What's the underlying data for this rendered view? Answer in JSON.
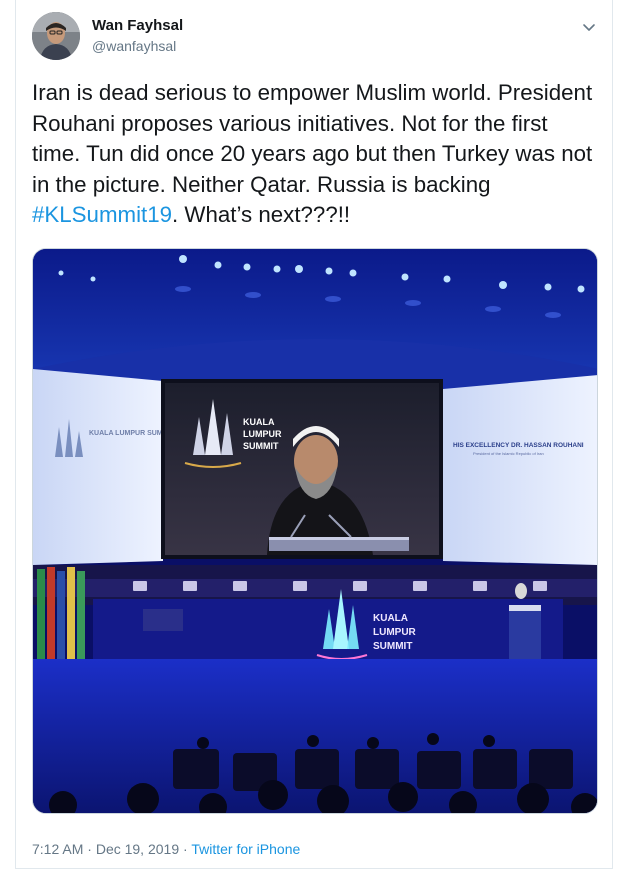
{
  "author": {
    "display_name": "Wan Fayhsal",
    "handle": "@wanfayhsal"
  },
  "tweet": {
    "text_before": "Iran is dead serious to empower Muslim world. President Rouhani proposes various initiatives.  Not for the first time. Tun did once 20 years ago but then Turkey was not in the picture. Neither Qatar. Russia is backing ",
    "hashtag": "#KLSummit19",
    "text_after": ". What’s next???!!"
  },
  "media": {
    "screen_left_text": "KUALA LUMPUR SUMMIT",
    "screen_center_line1": "KUALA",
    "screen_center_line2": "LUMPUR",
    "screen_center_line3": "SUMMIT",
    "screen_right_label": "HIS EXCELLENCY DR. HASSAN ROUHANI",
    "screen_right_sub": "President of the Islamic Republic of Iran",
    "stage_line1": "KUALA",
    "stage_line2": "LUMPUR",
    "stage_line3": "SUMMIT"
  },
  "meta": {
    "time": "7:12 AM",
    "separator": " · ",
    "date": "Dec 19, 2019",
    "separator2": " · ",
    "source": "Twitter for iPhone"
  },
  "colors": {
    "link": "#1b95e0",
    "muted": "#657786",
    "text": "#14171a"
  }
}
